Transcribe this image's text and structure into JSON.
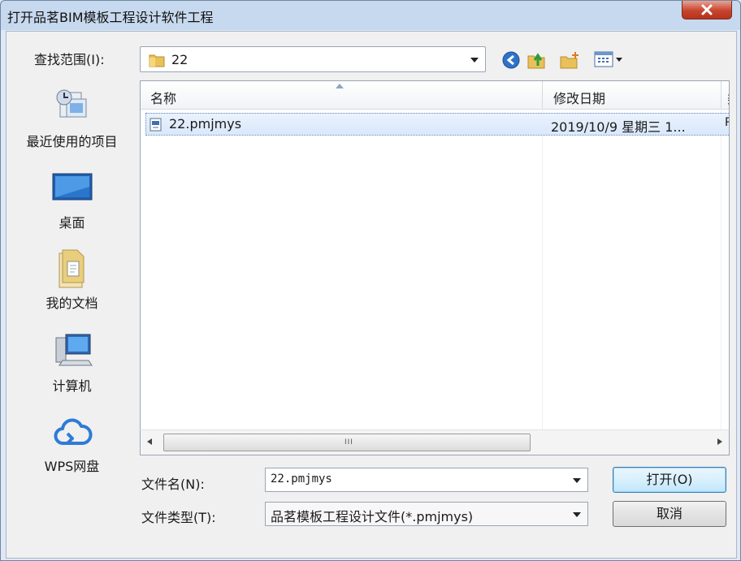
{
  "window": {
    "title": "打开品茗BIM模板工程设计软件工程",
    "close_symbol": "x"
  },
  "lookin": {
    "label": "查找范围(I):",
    "value": "22"
  },
  "toolbar": {
    "back_icon": "back-arrow-icon",
    "up_icon": "up-folder-icon",
    "new_folder_icon": "new-folder-icon",
    "views_icon": "views-menu-icon"
  },
  "places": [
    {
      "label": "最近使用的项目",
      "icon": "recent-items-icon"
    },
    {
      "label": "桌面",
      "icon": "desktop-icon"
    },
    {
      "label": "我的文档",
      "icon": "documents-icon"
    },
    {
      "label": "计算机",
      "icon": "computer-icon"
    },
    {
      "label": "WPS网盘",
      "icon": "cloud-icon"
    }
  ],
  "filelist": {
    "columns": [
      "名称",
      "修改日期",
      "类"
    ],
    "rows": [
      {
        "name": "22.pmjmys",
        "date": "2019/10/9 星期三 1...",
        "extra": "P",
        "selected": true
      }
    ],
    "scroll_grip": "III"
  },
  "filename": {
    "label": "文件名(N):",
    "value": "22.pmjmys"
  },
  "filetype": {
    "label": "文件类型(T):",
    "value": "品茗模板工程设计文件(*.pmjmys)"
  },
  "buttons": {
    "open": "打开(O)",
    "cancel": "取消"
  },
  "colors": {
    "title_bar": "#c7d9ee",
    "close_button": "#c7442e",
    "selection": "#d9e8fb"
  }
}
